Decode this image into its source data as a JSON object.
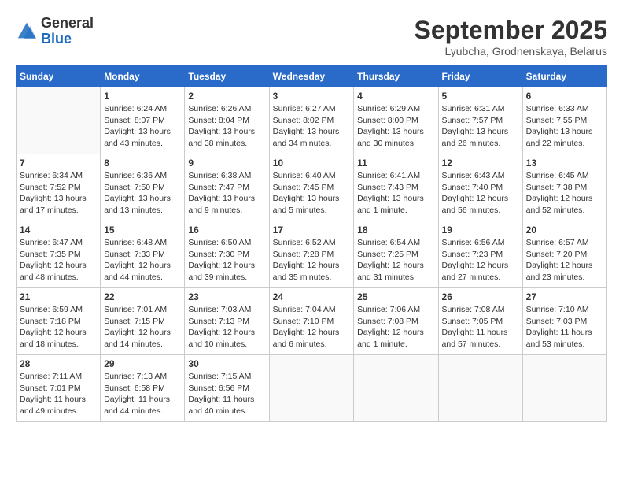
{
  "header": {
    "logo_general": "General",
    "logo_blue": "Blue",
    "month_title": "September 2025",
    "location": "Lyubcha, Grodnenskaya, Belarus"
  },
  "weekdays": [
    "Sunday",
    "Monday",
    "Tuesday",
    "Wednesday",
    "Thursday",
    "Friday",
    "Saturday"
  ],
  "weeks": [
    [
      {
        "day": "",
        "info": ""
      },
      {
        "day": "1",
        "info": "Sunrise: 6:24 AM\nSunset: 8:07 PM\nDaylight: 13 hours\nand 43 minutes."
      },
      {
        "day": "2",
        "info": "Sunrise: 6:26 AM\nSunset: 8:04 PM\nDaylight: 13 hours\nand 38 minutes."
      },
      {
        "day": "3",
        "info": "Sunrise: 6:27 AM\nSunset: 8:02 PM\nDaylight: 13 hours\nand 34 minutes."
      },
      {
        "day": "4",
        "info": "Sunrise: 6:29 AM\nSunset: 8:00 PM\nDaylight: 13 hours\nand 30 minutes."
      },
      {
        "day": "5",
        "info": "Sunrise: 6:31 AM\nSunset: 7:57 PM\nDaylight: 13 hours\nand 26 minutes."
      },
      {
        "day": "6",
        "info": "Sunrise: 6:33 AM\nSunset: 7:55 PM\nDaylight: 13 hours\nand 22 minutes."
      }
    ],
    [
      {
        "day": "7",
        "info": "Sunrise: 6:34 AM\nSunset: 7:52 PM\nDaylight: 13 hours\nand 17 minutes."
      },
      {
        "day": "8",
        "info": "Sunrise: 6:36 AM\nSunset: 7:50 PM\nDaylight: 13 hours\nand 13 minutes."
      },
      {
        "day": "9",
        "info": "Sunrise: 6:38 AM\nSunset: 7:47 PM\nDaylight: 13 hours\nand 9 minutes."
      },
      {
        "day": "10",
        "info": "Sunrise: 6:40 AM\nSunset: 7:45 PM\nDaylight: 13 hours\nand 5 minutes."
      },
      {
        "day": "11",
        "info": "Sunrise: 6:41 AM\nSunset: 7:43 PM\nDaylight: 13 hours\nand 1 minute."
      },
      {
        "day": "12",
        "info": "Sunrise: 6:43 AM\nSunset: 7:40 PM\nDaylight: 12 hours\nand 56 minutes."
      },
      {
        "day": "13",
        "info": "Sunrise: 6:45 AM\nSunset: 7:38 PM\nDaylight: 12 hours\nand 52 minutes."
      }
    ],
    [
      {
        "day": "14",
        "info": "Sunrise: 6:47 AM\nSunset: 7:35 PM\nDaylight: 12 hours\nand 48 minutes."
      },
      {
        "day": "15",
        "info": "Sunrise: 6:48 AM\nSunset: 7:33 PM\nDaylight: 12 hours\nand 44 minutes."
      },
      {
        "day": "16",
        "info": "Sunrise: 6:50 AM\nSunset: 7:30 PM\nDaylight: 12 hours\nand 39 minutes."
      },
      {
        "day": "17",
        "info": "Sunrise: 6:52 AM\nSunset: 7:28 PM\nDaylight: 12 hours\nand 35 minutes."
      },
      {
        "day": "18",
        "info": "Sunrise: 6:54 AM\nSunset: 7:25 PM\nDaylight: 12 hours\nand 31 minutes."
      },
      {
        "day": "19",
        "info": "Sunrise: 6:56 AM\nSunset: 7:23 PM\nDaylight: 12 hours\nand 27 minutes."
      },
      {
        "day": "20",
        "info": "Sunrise: 6:57 AM\nSunset: 7:20 PM\nDaylight: 12 hours\nand 23 minutes."
      }
    ],
    [
      {
        "day": "21",
        "info": "Sunrise: 6:59 AM\nSunset: 7:18 PM\nDaylight: 12 hours\nand 18 minutes."
      },
      {
        "day": "22",
        "info": "Sunrise: 7:01 AM\nSunset: 7:15 PM\nDaylight: 12 hours\nand 14 minutes."
      },
      {
        "day": "23",
        "info": "Sunrise: 7:03 AM\nSunset: 7:13 PM\nDaylight: 12 hours\nand 10 minutes."
      },
      {
        "day": "24",
        "info": "Sunrise: 7:04 AM\nSunset: 7:10 PM\nDaylight: 12 hours\nand 6 minutes."
      },
      {
        "day": "25",
        "info": "Sunrise: 7:06 AM\nSunset: 7:08 PM\nDaylight: 12 hours\nand 1 minute."
      },
      {
        "day": "26",
        "info": "Sunrise: 7:08 AM\nSunset: 7:05 PM\nDaylight: 11 hours\nand 57 minutes."
      },
      {
        "day": "27",
        "info": "Sunrise: 7:10 AM\nSunset: 7:03 PM\nDaylight: 11 hours\nand 53 minutes."
      }
    ],
    [
      {
        "day": "28",
        "info": "Sunrise: 7:11 AM\nSunset: 7:01 PM\nDaylight: 11 hours\nand 49 minutes."
      },
      {
        "day": "29",
        "info": "Sunrise: 7:13 AM\nSunset: 6:58 PM\nDaylight: 11 hours\nand 44 minutes."
      },
      {
        "day": "30",
        "info": "Sunrise: 7:15 AM\nSunset: 6:56 PM\nDaylight: 11 hours\nand 40 minutes."
      },
      {
        "day": "",
        "info": ""
      },
      {
        "day": "",
        "info": ""
      },
      {
        "day": "",
        "info": ""
      },
      {
        "day": "",
        "info": ""
      }
    ]
  ]
}
